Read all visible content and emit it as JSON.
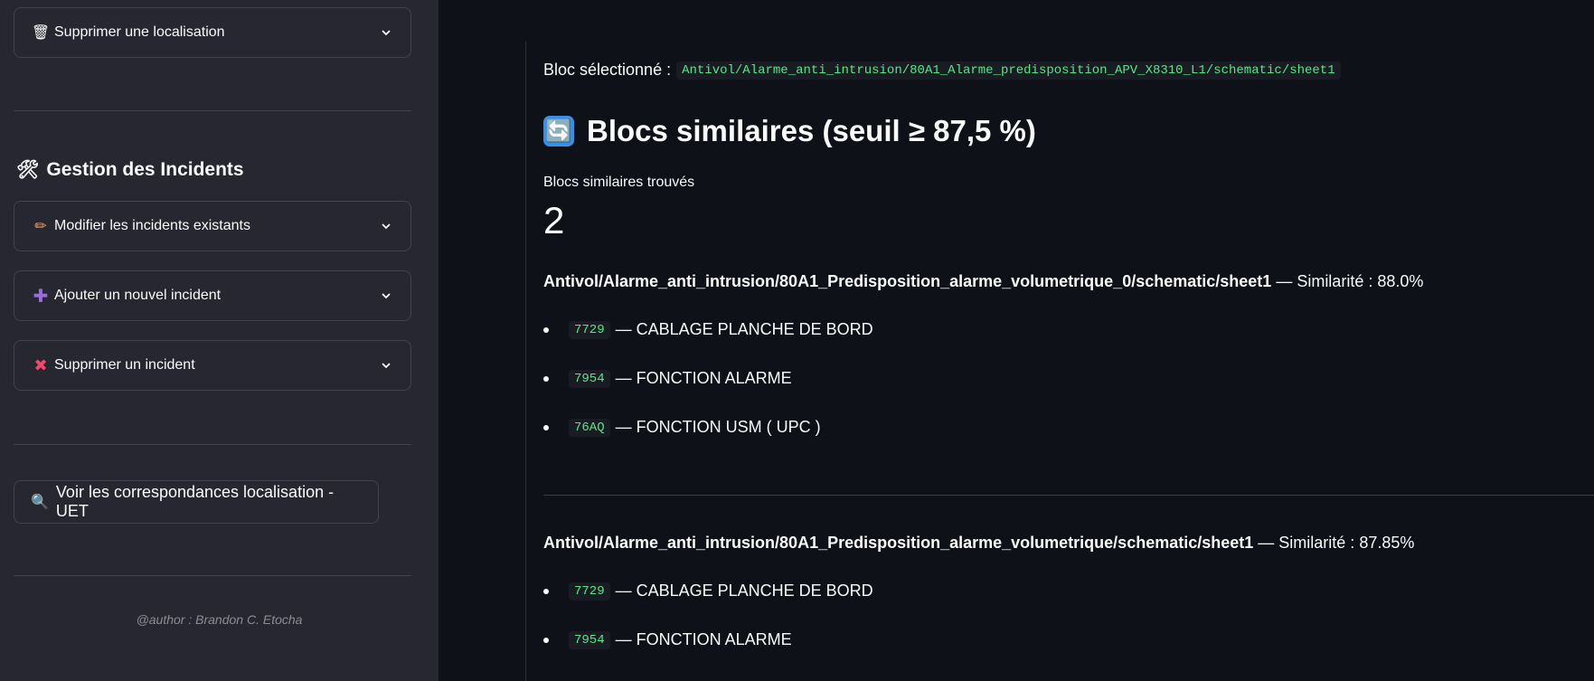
{
  "sidebar": {
    "expander_delete_location": {
      "icon": "wastebasket",
      "label": "Supprimer une localisation"
    },
    "incidents_heading": {
      "icon": "hammer-wrench",
      "label": "Gestion des Incidents"
    },
    "expanders": [
      {
        "icon": "pencil",
        "label": "Modifier les incidents existants"
      },
      {
        "icon": "plus",
        "label": "Ajouter un nouvel incident"
      },
      {
        "icon": "cross",
        "label": "Supprimer un incident"
      }
    ],
    "correspondence_button": {
      "icon": "magnifier",
      "label": "Voir les correspondances localisation - UET"
    },
    "author": "@author : Brandon C. Etocha"
  },
  "main": {
    "selected_label": "Bloc sélectionné :",
    "selected_block": "Antivol/Alarme_anti_intrusion/80A1_Alarme_predisposition_APV_X8310_L1/schematic/sheet1",
    "heading": "Blocs similaires (seuil ≥ 87,5 %)",
    "heading_icon": "arrows-refresh",
    "metric_label": "Blocs similaires trouvés",
    "metric_value": "2",
    "matches": [
      {
        "path": "Antivol/Alarme_anti_intrusion/80A1_Predisposition_alarme_volumetrique_0/schematic/sheet1",
        "similarity": "— Similarité : 88.0%",
        "items": [
          {
            "code": "7729",
            "desc": "— CABLAGE PLANCHE DE BORD"
          },
          {
            "code": "7954",
            "desc": "— FONCTION ALARME"
          },
          {
            "code": "76AQ",
            "desc": "— FONCTION USM ( UPC )"
          }
        ]
      },
      {
        "path": "Antivol/Alarme_anti_intrusion/80A1_Predisposition_alarme_volumetrique/schematic/sheet1",
        "similarity": "— Similarité : 87.85%",
        "items": [
          {
            "code": "7729",
            "desc": "— CABLAGE PLANCHE DE BORD"
          },
          {
            "code": "7954",
            "desc": "— FONCTION ALARME"
          }
        ]
      }
    ]
  },
  "colors": {
    "sidebar_bg": "#262730",
    "main_bg": "#0e1117",
    "code_green": "#5ce488"
  }
}
